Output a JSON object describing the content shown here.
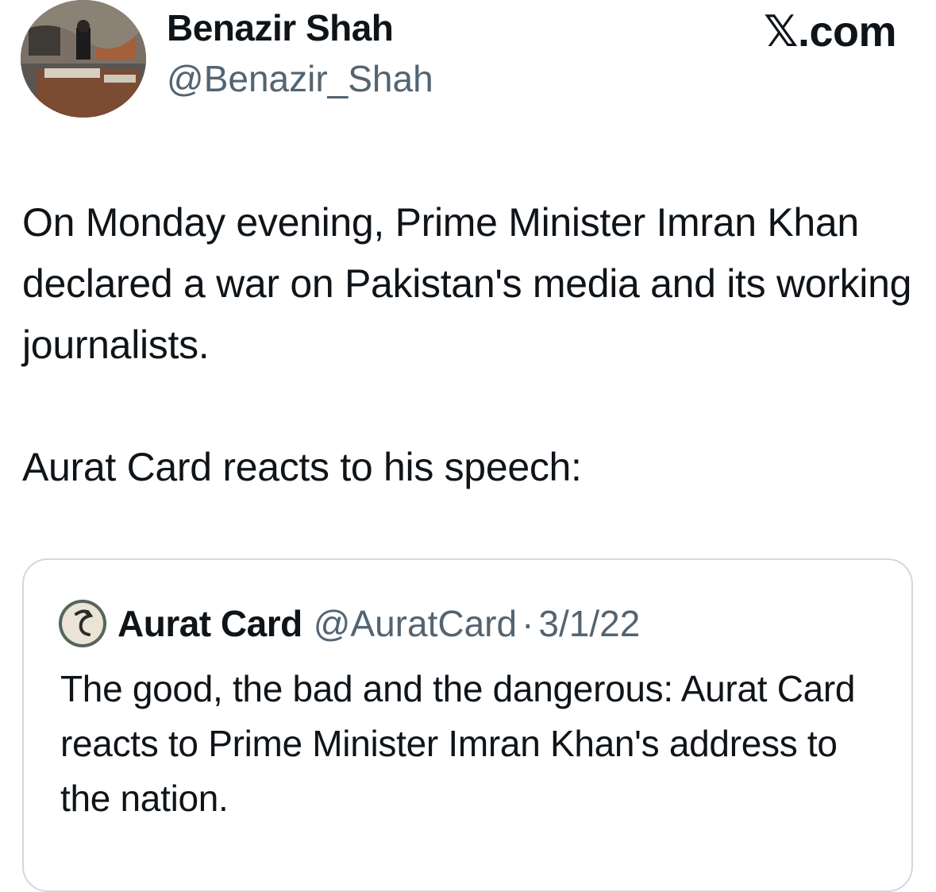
{
  "author": {
    "name": "Benazir Shah",
    "handle": "@Benazir_Shah"
  },
  "brand": {
    "logo_text": "𝕏.com"
  },
  "tweet": {
    "paragraphs": [
      "On Monday evening, Prime Minister Imran Khan declared a war on Pakistan's media and its working journalists.",
      "Aurat Card reacts to his speech:"
    ]
  },
  "quoted_tweet": {
    "name": "Aurat Card",
    "handle": "@AuratCard",
    "separator": "·",
    "date": "3/1/22",
    "text": "The good, the bad and the dangerous: Aurat Card reacts to Prime Minister Imran Khan's address to the nation."
  },
  "colors": {
    "text_primary": "#0f1419",
    "text_secondary": "#536471",
    "card_border": "#cfd9de"
  }
}
